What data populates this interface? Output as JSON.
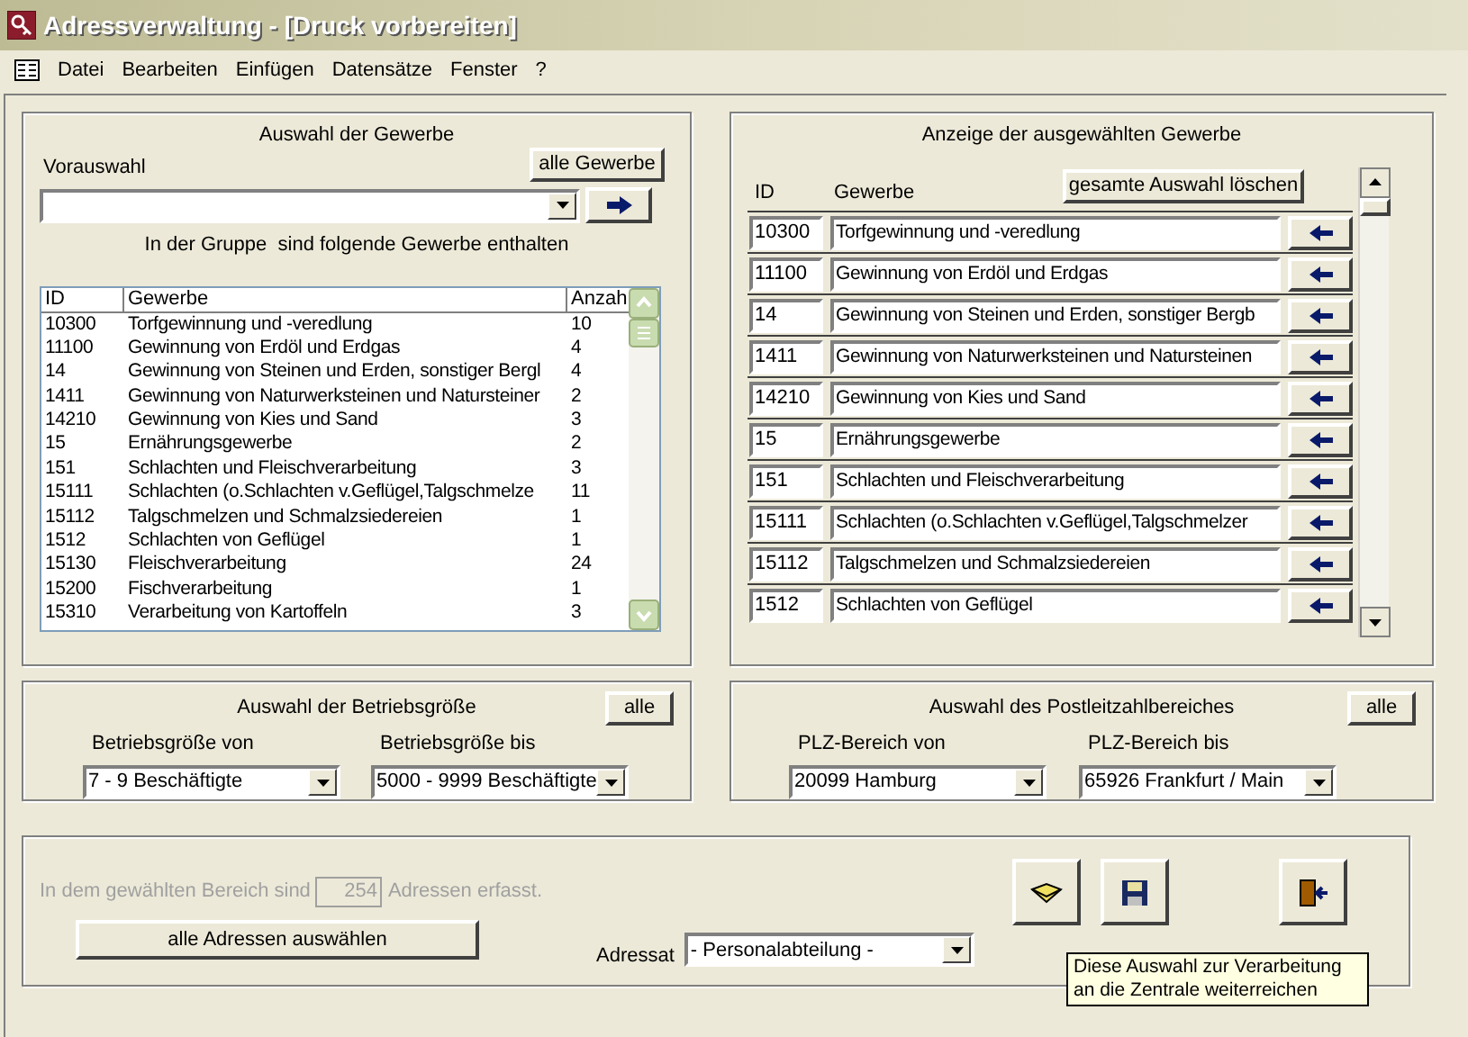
{
  "window": {
    "title": "Adressverwaltung - [Druck vorbereiten]"
  },
  "menu": [
    "Datei",
    "Bearbeiten",
    "Einfügen",
    "Datensätze",
    "Fenster",
    "?"
  ],
  "gewerbe_auswahl": {
    "title": "Auswahl der Gewerbe",
    "all_button": "alle Gewerbe",
    "preselect_label": "Vorauswahl",
    "info": "In der Gruppe  sind folgende Gewerbe enthalten",
    "columns": [
      "ID",
      "Gewerbe",
      "Anzah"
    ],
    "rows": [
      [
        "10300",
        "Torfgewinnung und -veredlung",
        "10"
      ],
      [
        "11100",
        "Gewinnung von Erdöl und Erdgas",
        "4"
      ],
      [
        "14",
        "Gewinnung von Steinen und Erden, sonstiger Bergl",
        "4"
      ],
      [
        "1411",
        "Gewinnung von Naturwerksteinen und Natursteiner",
        "2"
      ],
      [
        "14210",
        "Gewinnung von Kies und Sand",
        "3"
      ],
      [
        "15",
        "Ernährungsgewerbe",
        "2"
      ],
      [
        "151",
        "Schlachten und Fleischverarbeitung",
        "3"
      ],
      [
        "15111",
        "Schlachten (o.Schlachten v.Geflügel,Talgschmelze",
        "11"
      ],
      [
        "15112",
        "Talgschmelzen und Schmalzsiedereien",
        "1"
      ],
      [
        "1512",
        "Schlachten von Geflügel",
        "1"
      ],
      [
        "15130",
        "Fleischverarbeitung",
        "24"
      ],
      [
        "15200",
        "Fischverarbeitung",
        "1"
      ],
      [
        "15310",
        "Verarbeitung von Kartoffeln",
        "3"
      ]
    ]
  },
  "ausgewaehlt": {
    "title": "Anzeige der ausgewählten Gewerbe",
    "columns": [
      "ID",
      "Gewerbe"
    ],
    "clear_button": "gesamte Auswahl löschen",
    "rows": [
      {
        "id": "10300",
        "name": "Torfgewinnung und -veredlung"
      },
      {
        "id": "11100",
        "name": "Gewinnung von Erdöl und Erdgas"
      },
      {
        "id": "14",
        "name": "Gewinnung von Steinen und Erden, sonstiger Bergb"
      },
      {
        "id": "1411",
        "name": "Gewinnung von Naturwerksteinen und Natursteinen"
      },
      {
        "id": "14210",
        "name": "Gewinnung von Kies und Sand"
      },
      {
        "id": "15",
        "name": "Ernährungsgewerbe"
      },
      {
        "id": "151",
        "name": "Schlachten und Fleischverarbeitung"
      },
      {
        "id": "15111",
        "name": "Schlachten (o.Schlachten v.Geflügel,Talgschmelzer"
      },
      {
        "id": "15112",
        "name": "Talgschmelzen und Schmalzsiedereien"
      },
      {
        "id": "1512",
        "name": "Schlachten von Geflügel"
      }
    ]
  },
  "betriebsgroesse": {
    "title": "Auswahl der Betriebsgröße",
    "all_button": "alle",
    "from": {
      "label": "Betriebsgröße von",
      "value": "7 - 9 Beschäftigte"
    },
    "to": {
      "label": "Betriebsgröße bis",
      "value": "5000 - 9999 Beschäftigte"
    }
  },
  "plz": {
    "title": "Auswahl des Postleitzahlbereiches",
    "all_button": "alle",
    "from": {
      "label": "PLZ-Bereich von",
      "value": "20099  Hamburg"
    },
    "to": {
      "label": "PLZ-Bereich bis",
      "value": "65926  Frankfurt / Main"
    }
  },
  "summary": {
    "prefix": "In dem gewählten Bereich sind",
    "count": "254",
    "suffix": "Adressen erfasst.",
    "disabled": true
  },
  "select_all_button": "alle Adressen auswählen",
  "adressat": {
    "label": "Adressat",
    "value": "- Personalabteilung -"
  },
  "tooltip": "Diese Auswahl zur Verarbeitung\nan die Zentrale weiterreichen"
}
